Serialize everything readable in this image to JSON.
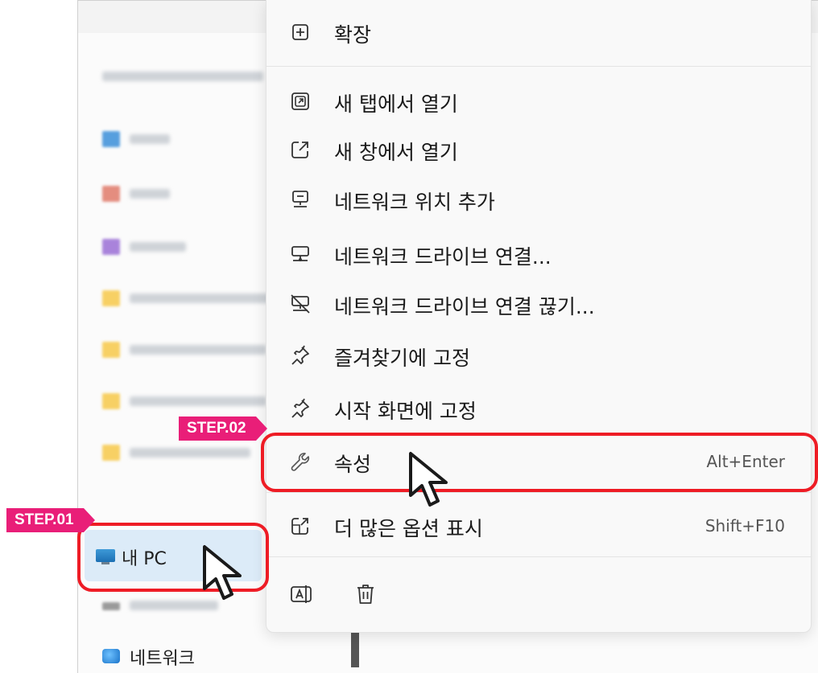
{
  "explorer": {
    "nav_items": [
      {
        "label": "내 PC"
      },
      {
        "label": "네트워크"
      }
    ]
  },
  "context_menu": {
    "items": [
      {
        "label": "확장",
        "icon": "expand-icon"
      },
      {
        "label": "새 탭에서 열기",
        "icon": "open-new-tab-icon"
      },
      {
        "label": "새 창에서 열기",
        "icon": "open-new-window-icon"
      },
      {
        "label": "네트워크 위치 추가",
        "icon": "add-network-location-icon"
      },
      {
        "label": "네트워크 드라이브 연결...",
        "icon": "map-network-drive-icon"
      },
      {
        "label": "네트워크 드라이브 연결 끊기...",
        "icon": "disconnect-network-drive-icon"
      },
      {
        "label": "즐겨찾기에 고정",
        "icon": "pin-icon"
      },
      {
        "label": "시작 화면에 고정",
        "icon": "pin-icon"
      },
      {
        "label": "속성",
        "shortcut": "Alt+Enter",
        "icon": "wrench-icon"
      },
      {
        "label": "더 많은 옵션 표시",
        "shortcut": "Shift+F10",
        "icon": "more-options-icon"
      }
    ],
    "bottom_icons": [
      "rename-icon",
      "trash-icon"
    ]
  },
  "annotations": {
    "step1": "STEP.01",
    "step2": "STEP.02",
    "highlight_color": "#ee1c25",
    "tag_color": "#e91e78"
  }
}
